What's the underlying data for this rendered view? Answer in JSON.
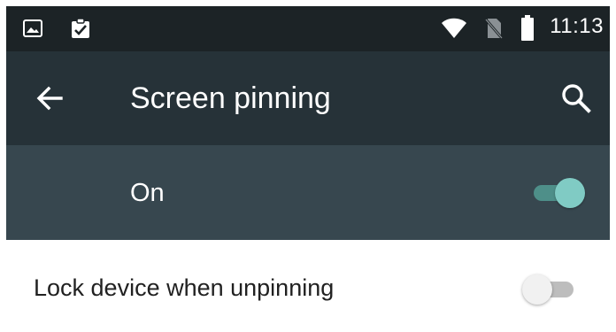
{
  "status_bar": {
    "time": "11:13",
    "icons": [
      "image-icon",
      "clipboard-check-icon",
      "wifi-icon",
      "no-sim-icon",
      "battery-icon"
    ]
  },
  "app_bar": {
    "title": "Screen pinning",
    "back_icon": "arrow-back-icon",
    "search_icon": "search-icon"
  },
  "master_switch": {
    "label": "On",
    "checked": true
  },
  "settings": {
    "lock_device": {
      "label": "Lock device when unpinning",
      "checked": false
    }
  },
  "colors": {
    "status_bar": "#1c2326",
    "app_bar": "#263238",
    "master_row": "#37474f",
    "accent": "#80cbc4"
  }
}
